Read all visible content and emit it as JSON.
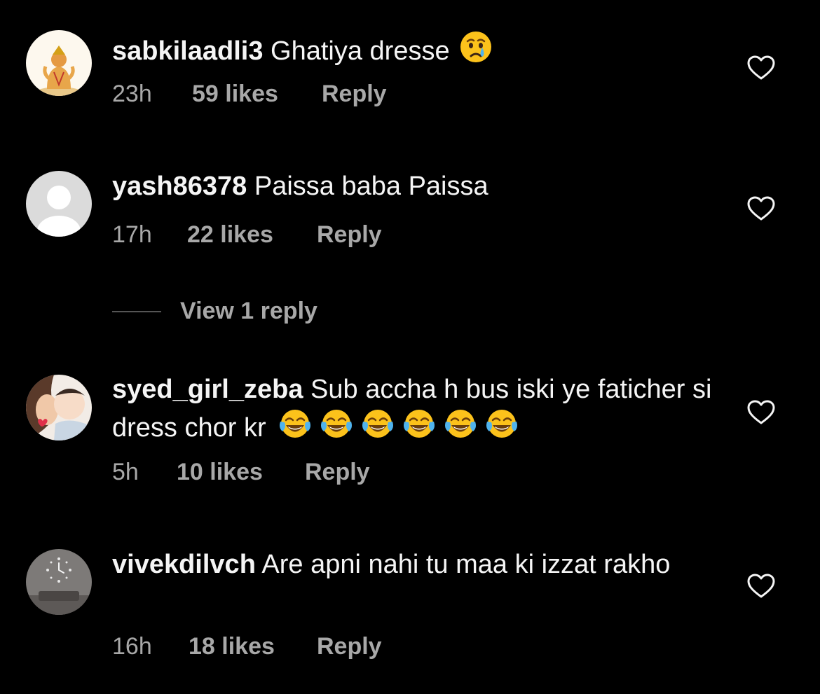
{
  "colors": {
    "background": "#000000",
    "primary_text": "#f5f5f5",
    "secondary_text": "#a8a8a8",
    "divider": "#555555"
  },
  "comments": [
    {
      "avatar": "hanuman-avatar",
      "username": "sabkilaadli3",
      "text": "Ghatiya dresse",
      "emoji": "crying-face-emoji",
      "time": "23h",
      "likes": "59 likes",
      "reply": "Reply"
    },
    {
      "avatar": "default-profile-avatar",
      "username": "yash86378",
      "text": "Paissa baba Paissa",
      "time": "17h",
      "likes": "22 likes",
      "reply": "Reply",
      "view_replies": "View 1 reply"
    },
    {
      "avatar": "mother-child-avatar",
      "username": "syed_girl_zeba",
      "text": "Sub accha h bus iski ye faticher si dress chor kr",
      "emoji": "face-with-tears-of-joy-emoji",
      "emoji_count": 6,
      "time": "5h",
      "likes": "10 likes",
      "reply": "Reply"
    },
    {
      "avatar": "wall-clock-room-avatar",
      "username": "vivekdilvch",
      "text": "Are apni nahi tu maa ki izzat rakho",
      "time": "16h",
      "likes": "18 likes",
      "reply": "Reply"
    }
  ]
}
